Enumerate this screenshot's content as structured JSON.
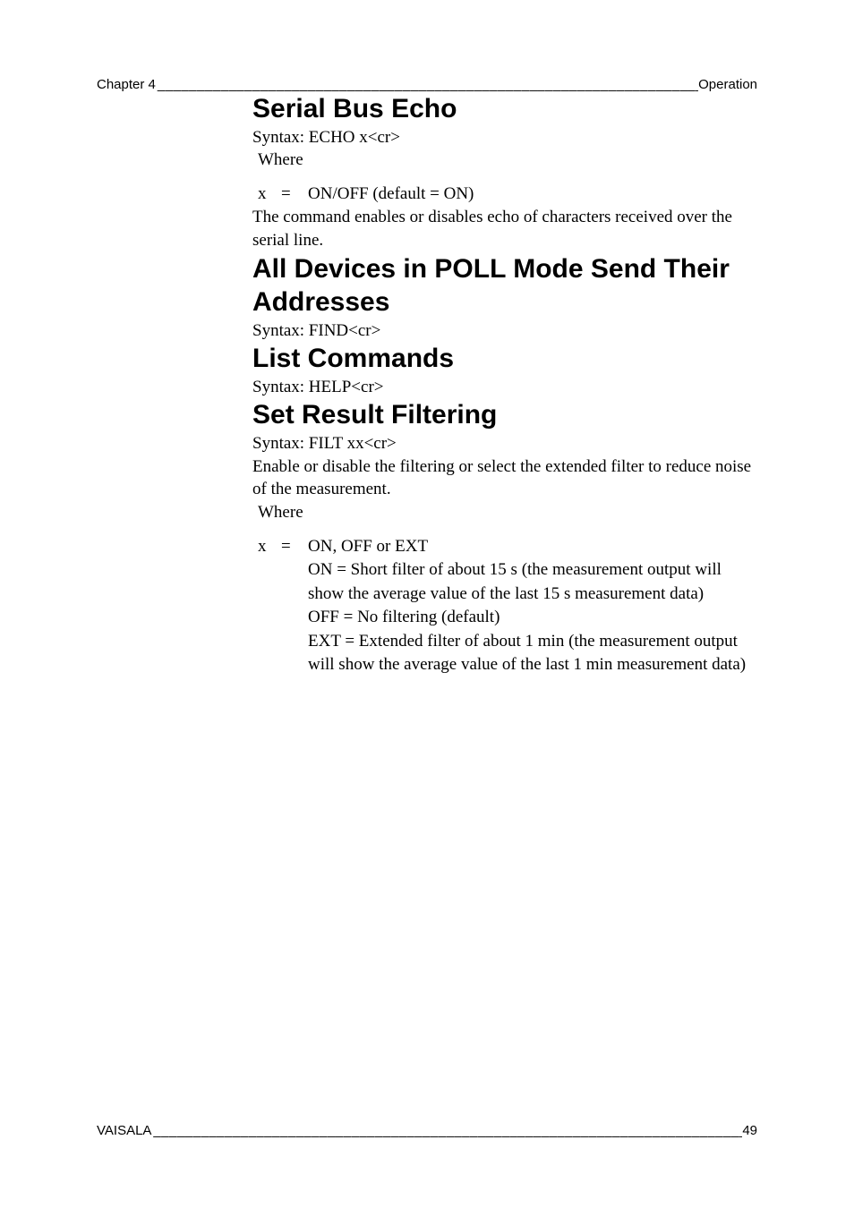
{
  "header": {
    "left": "Chapter 4",
    "fill": "____________________________________________________________________________",
    "right": "Operation"
  },
  "sections": {
    "echo": {
      "title": "Serial Bus Echo",
      "syntax": "Syntax: ECHO x<cr>",
      "where_label": "Where",
      "where_var": "x",
      "where_eq": "=",
      "where_desc": "ON/OFF (default = ON)",
      "para": "The command enables or disables echo of characters received over the serial line."
    },
    "find": {
      "title": "All Devices in POLL Mode Send Their Addresses",
      "syntax": "Syntax: FIND<cr>"
    },
    "help": {
      "title": "List Commands",
      "syntax": "Syntax: HELP<cr>"
    },
    "filt": {
      "title": "Set Result Filtering",
      "syntax": "Syntax: FILT xx<cr>",
      "para": "Enable or disable the filtering or select the extended filter to reduce noise of the measurement.",
      "where_label": "Where",
      "where_var": "x",
      "where_eq": "=",
      "desc_line1": "ON, OFF or EXT",
      "desc_line2": "ON = Short filter of about 15 s (the measurement output will show the average value of the last 15 s measurement data)",
      "desc_line3": "OFF = No filtering (default)",
      "desc_line4": "EXT = Extended filter of about 1 min (the measurement output will show the average value of the last 1 min measurement data)"
    }
  },
  "footer": {
    "left": "VAISALA",
    "fill": "_______________________________________________________________________________",
    "right": "49"
  }
}
